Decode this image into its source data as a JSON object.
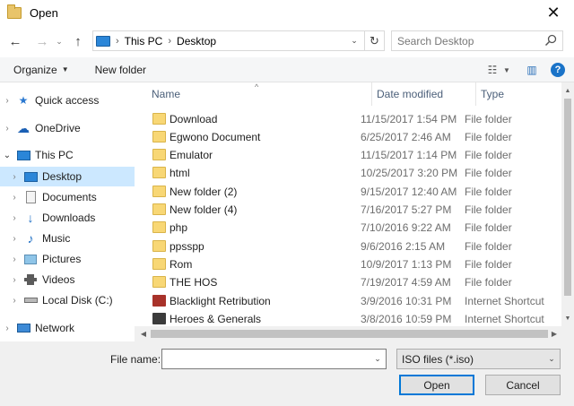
{
  "window": {
    "title": "Open",
    "close_glyph": "✕"
  },
  "navigation": {
    "back_glyph": "←",
    "forward_glyph": "→",
    "recent_glyph": "⌄",
    "up_glyph": "↑",
    "address": {
      "icon": "this-pc-icon",
      "sep": "›",
      "crumbs": [
        "This PC",
        "Desktop"
      ],
      "dropdown_glyph": "⌄",
      "refresh_glyph": "↻"
    },
    "search": {
      "placeholder": "Search Desktop",
      "icon": "search-icon"
    }
  },
  "commandbar": {
    "organize": "Organize",
    "organize_caret": "▼",
    "new_folder": "New folder",
    "view_glyph": "☷",
    "view_caret": "▼",
    "preview_glyph": "▥",
    "help_glyph": "?"
  },
  "sidebar": {
    "items": [
      {
        "label": "Quick access",
        "icon": "star-icon",
        "chev": "›"
      },
      {
        "label": "OneDrive",
        "icon": "cloud-icon",
        "chev": "›"
      },
      {
        "label": "This PC",
        "icon": "this-pc-icon",
        "chev": "⌄"
      },
      {
        "label": "Desktop",
        "icon": "desktop-icon",
        "chev": "›",
        "selected": true
      },
      {
        "label": "Documents",
        "icon": "documents-icon",
        "chev": "›"
      },
      {
        "label": "Downloads",
        "icon": "downloads-icon",
        "chev": "›"
      },
      {
        "label": "Music",
        "icon": "music-icon",
        "chev": "›"
      },
      {
        "label": "Pictures",
        "icon": "pictures-icon",
        "chev": "›"
      },
      {
        "label": "Videos",
        "icon": "videos-icon",
        "chev": "›"
      },
      {
        "label": "Local Disk (C:)",
        "icon": "drive-icon",
        "chev": "›"
      },
      {
        "label": "Network",
        "icon": "network-icon",
        "chev": "›"
      }
    ]
  },
  "filelist": {
    "sort_glyph": "^",
    "columns": {
      "name": "Name",
      "date": "Date modified",
      "type": "Type"
    },
    "rows": [
      {
        "name": "Download",
        "date": "11/15/2017 1:54 PM",
        "type": "File folder",
        "icon": "folder-icon"
      },
      {
        "name": "Egwono Document",
        "date": "6/25/2017 2:46 AM",
        "type": "File folder",
        "icon": "folder-icon"
      },
      {
        "name": "Emulator",
        "date": "11/15/2017 1:14 PM",
        "type": "File folder",
        "icon": "folder-icon"
      },
      {
        "name": "html",
        "date": "10/25/2017 3:20 PM",
        "type": "File folder",
        "icon": "folder-icon"
      },
      {
        "name": "New folder (2)",
        "date": "9/15/2017 12:40 AM",
        "type": "File folder",
        "icon": "folder-icon"
      },
      {
        "name": "New folder (4)",
        "date": "7/16/2017 5:27 PM",
        "type": "File folder",
        "icon": "folder-icon"
      },
      {
        "name": "php",
        "date": "7/10/2016 9:22 AM",
        "type": "File folder",
        "icon": "folder-icon"
      },
      {
        "name": "ppsspp",
        "date": "9/6/2016 2:15 AM",
        "type": "File folder",
        "icon": "folder-icon"
      },
      {
        "name": "Rom",
        "date": "10/9/2017 1:13 PM",
        "type": "File folder",
        "icon": "folder-icon"
      },
      {
        "name": "THE HOS",
        "date": "7/19/2017 4:59 AM",
        "type": "File folder",
        "icon": "folder-icon"
      },
      {
        "name": "Blacklight Retribution",
        "date": "3/9/2016 10:31 PM",
        "type": "Internet Shortcut",
        "icon": "game-shortcut-icon"
      },
      {
        "name": "Heroes & Generals",
        "date": "3/8/2016 10:59 PM",
        "type": "Internet Shortcut",
        "icon": "game-shortcut-icon"
      }
    ]
  },
  "scroll": {
    "up": "▲",
    "down": "▼",
    "left": "◀",
    "right": "▶"
  },
  "bottom": {
    "file_name_label": "File name:",
    "file_name_value": "",
    "file_name_dropdown": "⌄",
    "file_type": "ISO files (*.iso)",
    "file_type_dropdown": "⌄",
    "open_label": "Open",
    "cancel_label": "Cancel"
  },
  "colors": {
    "selection": "#cce8ff",
    "accent": "#0078d7",
    "folder": "#f8d775"
  }
}
